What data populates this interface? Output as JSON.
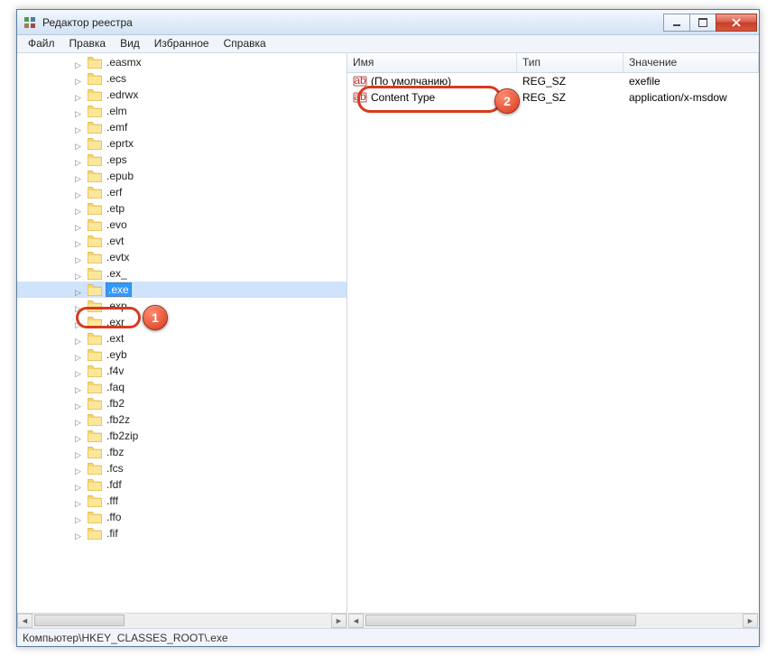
{
  "window": {
    "title": "Редактор реестра"
  },
  "menu": {
    "items": [
      "Файл",
      "Правка",
      "Вид",
      "Избранное",
      "Справка"
    ]
  },
  "tree": {
    "items": [
      {
        "label": ".easmx"
      },
      {
        "label": ".ecs"
      },
      {
        "label": ".edrwx"
      },
      {
        "label": ".elm"
      },
      {
        "label": ".emf"
      },
      {
        "label": ".eprtx"
      },
      {
        "label": ".eps"
      },
      {
        "label": ".epub"
      },
      {
        "label": ".erf"
      },
      {
        "label": ".etp"
      },
      {
        "label": ".evo"
      },
      {
        "label": ".evt"
      },
      {
        "label": ".evtx"
      },
      {
        "label": ".ex_"
      },
      {
        "label": ".exe",
        "selected": true
      },
      {
        "label": ".exp"
      },
      {
        "label": ".exr"
      },
      {
        "label": ".ext"
      },
      {
        "label": ".eyb"
      },
      {
        "label": ".f4v"
      },
      {
        "label": ".faq"
      },
      {
        "label": ".fb2"
      },
      {
        "label": ".fb2z"
      },
      {
        "label": ".fb2zip"
      },
      {
        "label": ".fbz"
      },
      {
        "label": ".fcs"
      },
      {
        "label": ".fdf"
      },
      {
        "label": ".fff"
      },
      {
        "label": ".ffo"
      },
      {
        "label": ".fif"
      }
    ]
  },
  "list": {
    "headers": {
      "name": "Имя",
      "type": "Тип",
      "value": "Значение"
    },
    "rows": [
      {
        "name": "(По умолчанию)",
        "type": "REG_SZ",
        "value": "exefile"
      },
      {
        "name": "Content Type",
        "type": "REG_SZ",
        "value": "application/x-msdow"
      }
    ]
  },
  "statusbar": {
    "path": "Компьютер\\HKEY_CLASSES_ROOT\\.exe"
  },
  "annotations": {
    "badge1": "1",
    "badge2": "2"
  }
}
